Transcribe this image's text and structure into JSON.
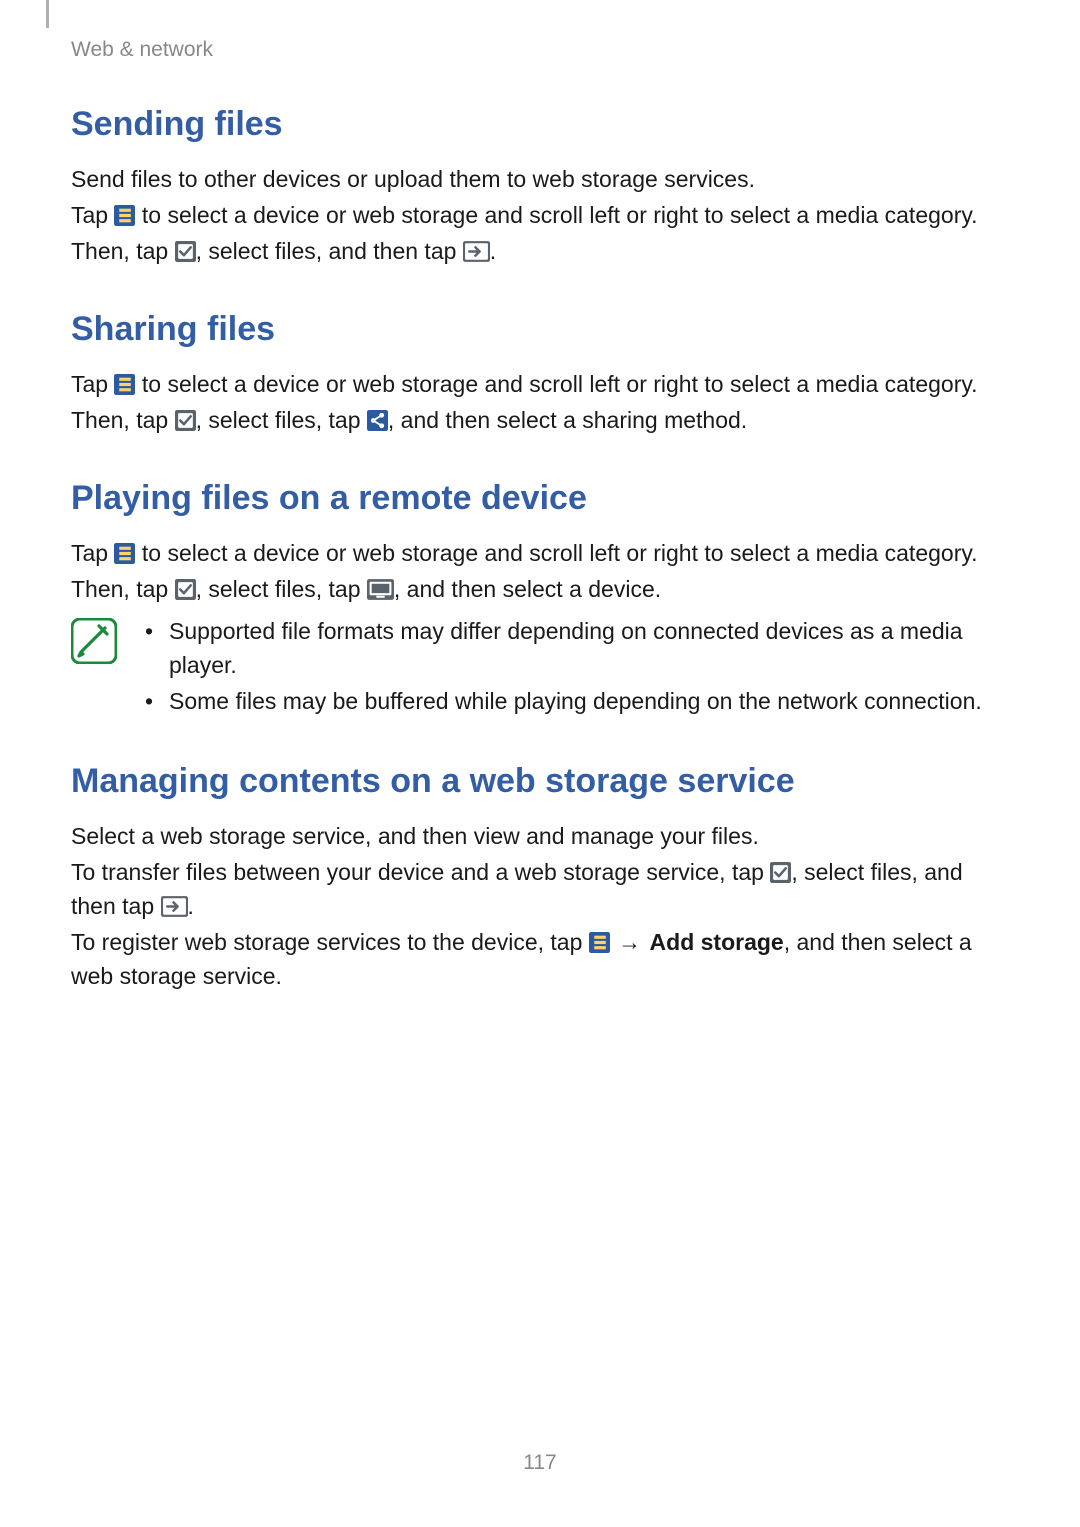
{
  "breadcrumb": "Web & network",
  "page_number": "117",
  "icons": {
    "list": "list-icon",
    "checkbox": "checkbox-icon",
    "send": "send-arrow-icon",
    "share": "share-icon",
    "cast": "cast-screen-icon",
    "note": "note-icon"
  },
  "sections": [
    {
      "heading": "Sending files",
      "p1_a": "Send files to other devices or upload them to web storage services.",
      "p2_a": "Tap ",
      "p2_b": " to select a device or web storage and scroll left or right to select a media category.",
      "p3_a": "Then, tap ",
      "p3_b": ", select files, and then tap ",
      "p3_c": "."
    },
    {
      "heading": "Sharing files",
      "p1_a": "Tap ",
      "p1_b": " to select a device or web storage and scroll left or right to select a media category.",
      "p2_a": "Then, tap ",
      "p2_b": ", select files, tap ",
      "p2_c": ", and then select a sharing method."
    },
    {
      "heading": "Playing files on a remote device",
      "p1_a": "Tap ",
      "p1_b": " to select a device or web storage and scroll left or right to select a media category.",
      "p2_a": "Then, tap ",
      "p2_b": ", select files, tap ",
      "p2_c": ", and then select a device.",
      "note_items": [
        "Supported file formats may differ depending on connected devices as a media player.",
        "Some files may be buffered while playing depending on the network connection."
      ]
    },
    {
      "heading": "Managing contents on a web storage service",
      "p1_a": "Select a web storage service, and then view and manage your files.",
      "p2_a": "To transfer files between your device and a web storage service, tap ",
      "p2_b": ", select files, and then tap ",
      "p2_c": ".",
      "p3_a": "To register web storage services to the device, tap ",
      "p3_arrow": " → ",
      "p3_bold": "Add storage",
      "p3_b": ", and then select a web storage service."
    }
  ]
}
